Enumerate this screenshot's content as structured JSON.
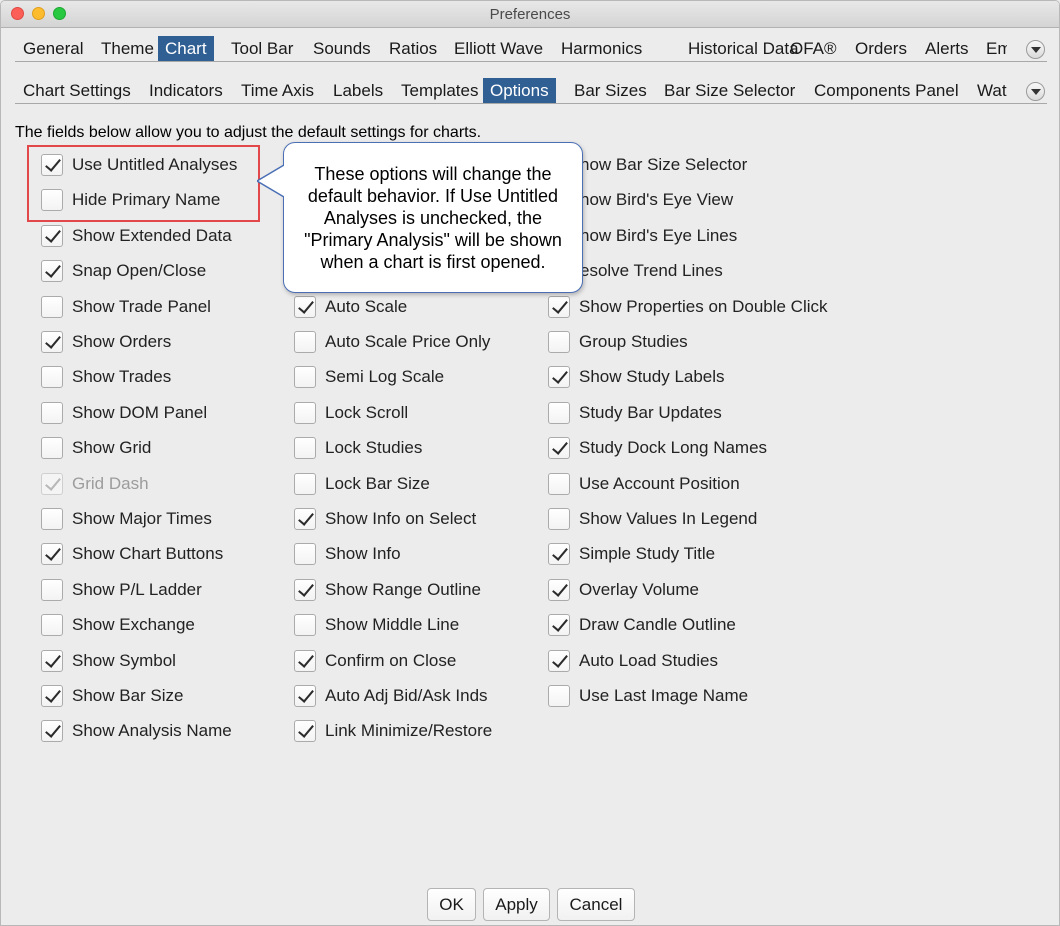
{
  "window": {
    "title": "Preferences"
  },
  "top_tabs": [
    {
      "label": "General",
      "active": false
    },
    {
      "label": "Theme",
      "active": false
    },
    {
      "label": "Chart",
      "active": true
    },
    {
      "label": "Tool Bar",
      "active": false
    },
    {
      "label": "Sounds",
      "active": false
    },
    {
      "label": "Ratios",
      "active": false
    },
    {
      "label": "Elliott Wave",
      "active": false
    },
    {
      "label": "Harmonics",
      "active": false
    },
    {
      "label": "Historical Data",
      "active": false
    },
    {
      "label": "OFA®",
      "active": false
    },
    {
      "label": "Orders",
      "active": false
    },
    {
      "label": "Alerts",
      "active": false
    },
    {
      "label": "Ema",
      "active": false
    }
  ],
  "sub_tabs": [
    {
      "label": "Chart Settings",
      "active": false
    },
    {
      "label": "Indicators",
      "active": false
    },
    {
      "label": "Time Axis",
      "active": false
    },
    {
      "label": "Labels",
      "active": false
    },
    {
      "label": "Templates",
      "active": false
    },
    {
      "label": "Options",
      "active": true
    },
    {
      "label": "Bar Sizes",
      "active": false
    },
    {
      "label": "Bar Size Selector",
      "active": false
    },
    {
      "label": "Components Panel",
      "active": false
    },
    {
      "label": "Wate",
      "active": false
    }
  ],
  "description": "The fields below allow you to adjust the default settings for charts.",
  "options": {
    "col1": [
      {
        "label": "Use Untitled Analyses",
        "checked": true,
        "disabled": false
      },
      {
        "label": "Hide Primary Name",
        "checked": false,
        "disabled": false
      },
      {
        "label": "Show Extended Data",
        "checked": true,
        "disabled": false
      },
      {
        "label": "Snap Open/Close",
        "checked": true,
        "disabled": false
      },
      {
        "label": "Show Trade Panel",
        "checked": false,
        "disabled": false
      },
      {
        "label": "Show Orders",
        "checked": true,
        "disabled": false
      },
      {
        "label": "Show Trades",
        "checked": false,
        "disabled": false
      },
      {
        "label": "Show DOM Panel",
        "checked": false,
        "disabled": false
      },
      {
        "label": "Show Grid",
        "checked": false,
        "disabled": false
      },
      {
        "label": "Grid Dash",
        "checked": true,
        "disabled": true
      },
      {
        "label": "Show Major Times",
        "checked": false,
        "disabled": false
      },
      {
        "label": "Show Chart Buttons",
        "checked": true,
        "disabled": false
      },
      {
        "label": "Show P/L Ladder",
        "checked": false,
        "disabled": false
      },
      {
        "label": "Show Exchange",
        "checked": false,
        "disabled": false
      },
      {
        "label": "Show Symbol",
        "checked": true,
        "disabled": false
      },
      {
        "label": "Show Bar Size",
        "checked": true,
        "disabled": false
      },
      {
        "label": "Show Analysis Name",
        "checked": true,
        "disabled": false
      }
    ],
    "col2": [
      {
        "label": "Auto Scale",
        "checked": true,
        "disabled": false
      },
      {
        "label": "Auto Scale Price Only",
        "checked": false,
        "disabled": false
      },
      {
        "label": "Semi Log Scale",
        "checked": false,
        "disabled": false
      },
      {
        "label": "Lock Scroll",
        "checked": false,
        "disabled": false
      },
      {
        "label": "Lock Studies",
        "checked": false,
        "disabled": false
      },
      {
        "label": "Lock Bar Size",
        "checked": false,
        "disabled": false
      },
      {
        "label": "Show Info on Select",
        "checked": true,
        "disabled": false
      },
      {
        "label": "Show Info",
        "checked": false,
        "disabled": false
      },
      {
        "label": "Show Range Outline",
        "checked": true,
        "disabled": false
      },
      {
        "label": "Show Middle Line",
        "checked": false,
        "disabled": false
      },
      {
        "label": "Confirm on Close",
        "checked": true,
        "disabled": false
      },
      {
        "label": "Auto Adj Bid/Ask Inds",
        "checked": true,
        "disabled": false
      },
      {
        "label": "Link Minimize/Restore",
        "checked": true,
        "disabled": false
      }
    ],
    "col3_hidden": [
      {
        "label": "how Bar Size Selector"
      },
      {
        "label": "how Bird's Eye View"
      },
      {
        "label": "how Bird's Eye Lines"
      },
      {
        "label": "esolve Trend Lines"
      }
    ],
    "col3": [
      {
        "label": "Show Properties on Double Click",
        "checked": true,
        "disabled": false
      },
      {
        "label": "Group Studies",
        "checked": false,
        "disabled": false
      },
      {
        "label": "Show Study Labels",
        "checked": true,
        "disabled": false
      },
      {
        "label": "Study Bar Updates",
        "checked": false,
        "disabled": false
      },
      {
        "label": "Study Dock Long Names",
        "checked": true,
        "disabled": false
      },
      {
        "label": "Use Account Position",
        "checked": false,
        "disabled": false
      },
      {
        "label": "Show Values In Legend",
        "checked": false,
        "disabled": false
      },
      {
        "label": "Simple Study Title",
        "checked": true,
        "disabled": false
      },
      {
        "label": "Overlay Volume",
        "checked": true,
        "disabled": false
      },
      {
        "label": "Draw Candle Outline",
        "checked": true,
        "disabled": false
      },
      {
        "label": "Auto Load Studies",
        "checked": true,
        "disabled": false
      },
      {
        "label": "Use Last Image Name",
        "checked": false,
        "disabled": false
      }
    ]
  },
  "callout": {
    "lines": [
      "These options will change the",
      "default behavior. If Use Untitled",
      "Analyses is unchecked, the",
      "\"Primary Analysis\" will be shown",
      "when a chart is first opened."
    ]
  },
  "buttons": {
    "ok": "OK",
    "apply": "Apply",
    "cancel": "Cancel"
  },
  "colors": {
    "active_tab": "#2f5f93",
    "highlight": "#e2474a",
    "callout_border": "#4a6fb5"
  }
}
